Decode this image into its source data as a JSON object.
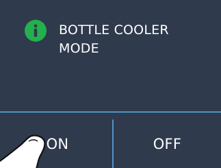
{
  "dialog": {
    "title": "BOTTLE COOLER\nMODE",
    "icon": "info-icon",
    "icon_color": "#22b14c"
  },
  "buttons": {
    "on_label": "ON",
    "off_label": "OFF"
  },
  "colors": {
    "background": "#2f3a4c",
    "divider": "#4f93c7",
    "text": "#ffffff"
  }
}
